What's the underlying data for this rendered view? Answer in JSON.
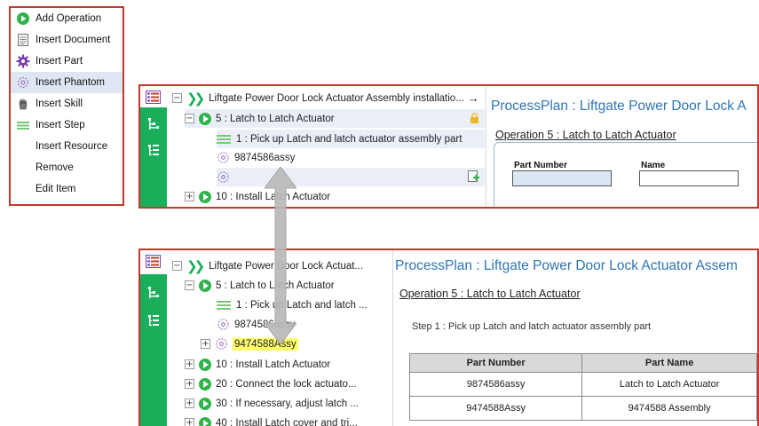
{
  "menu": {
    "items": [
      {
        "label": "Add Operation",
        "icon": "play-icon"
      },
      {
        "label": "Insert Document",
        "icon": "document-icon"
      },
      {
        "label": "Insert Part",
        "icon": "part-gear-icon"
      },
      {
        "label": "Insert Phantom",
        "icon": "phantom-gear-icon"
      },
      {
        "label": "Insert Skill",
        "icon": "hand-icon"
      },
      {
        "label": "Insert Step",
        "icon": "step-lines-icon"
      },
      {
        "label": "Insert Resource",
        "icon": ""
      },
      {
        "label": "Remove",
        "icon": ""
      },
      {
        "label": "Edit Item",
        "icon": ""
      }
    ],
    "active": "Insert Phantom"
  },
  "top_panel": {
    "tree": {
      "root": "Liftgate Power Door Lock Actuator Assembly installatio...",
      "root_arrow": "→",
      "op5": "5 : Latch to Latch Actuator",
      "step1": "1 : Pick up Latch and latch actuator assembly part",
      "part": "9874586assy",
      "op10": "10 : Install Latch Actuator"
    },
    "content": {
      "title": "ProcessPlan : Liftgate Power Door Lock A",
      "operation": "Operation 5 : Latch to Latch Actuator",
      "label_part_number": "Part Number",
      "label_name": "Name"
    }
  },
  "bottom_panel": {
    "tree": {
      "root": "Liftgate Power Door Lock Actuat...",
      "op5": "5 : Latch to Latch Actuator",
      "step1": "1 : Pick up Latch and latch ...",
      "part": "9874586assy",
      "new_part": "9474588Assy",
      "op10": "10 : Install Latch Actuator",
      "op20": "20 : Connect the lock actuato...",
      "op30": "30 : If necessary, adjust latch ...",
      "op40": "40 : Install Latch cover and tri..."
    },
    "content": {
      "title": "ProcessPlan : Liftgate Power Door Lock Actuator Assem",
      "operation": "Operation 5 : Latch to Latch Actuator",
      "step": "Step 1 : Pick up Latch and latch actuator assembly part",
      "table": {
        "headers": [
          "Part Number",
          "Part Name"
        ],
        "rows": [
          [
            "9874586assy",
            "Latch to Latch Actuator"
          ],
          [
            "9474588Assy",
            "9474588 Assembly"
          ]
        ]
      }
    }
  },
  "colors": {
    "panel_border": "#c0392b",
    "green_bar": "#1aae5b",
    "title_blue": "#2f75b5",
    "highlight_yellow": "#ffff66"
  }
}
